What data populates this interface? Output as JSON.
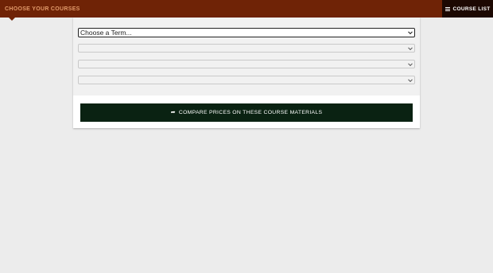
{
  "header": {
    "brand_label": "CHOOSE YOUR COURSES",
    "course_list_label": "COURSE LIST",
    "course_list_icon": "hamburger-menu-icon",
    "bar_color": "#6f2306",
    "button_color": "#1c0802"
  },
  "form": {
    "term_select": {
      "selected": "Choose a Term..."
    },
    "department_select": {
      "selected": ""
    },
    "course_select": {
      "selected": ""
    },
    "section_select": {
      "selected": ""
    },
    "compare_button": {
      "label": "COMPARE PRICES ON THESE COURSE MATERIALS",
      "icon": "share-arrow-icon",
      "color": "#0a2212"
    }
  }
}
